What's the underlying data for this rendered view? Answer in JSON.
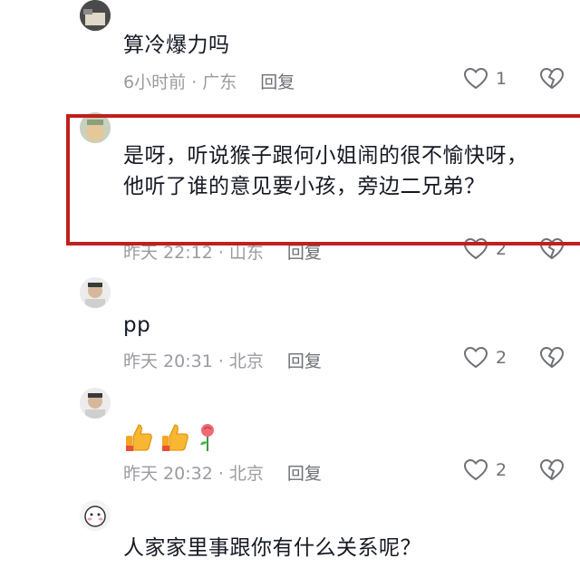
{
  "comments": [
    {
      "username": "",
      "content": "算冷爆力吗",
      "time_loc": "6小时前 · 广东",
      "reply_label": "回复",
      "likes": "1"
    },
    {
      "username": "",
      "content": "是呀，听说猴子跟何小姐闹的很不愉快呀，他听了谁的意见要小孩，旁边二兄弟？",
      "time_loc": "昨天 22:12 · 山东",
      "reply_label": "回复",
      "likes": "2"
    },
    {
      "username": "",
      "content": "pp",
      "time_loc": "昨天 20:31 · 北京",
      "reply_label": "回复",
      "likes": "2"
    },
    {
      "username": "",
      "content": "",
      "emojis": [
        "thumbs-up",
        "thumbs-up",
        "rose"
      ],
      "time_loc": "昨天 20:32 · 北京",
      "reply_label": "回复",
      "likes": "2"
    },
    {
      "username": "",
      "content": "人家家里事跟你有什么关系呢？"
    }
  ],
  "colors": {
    "highlight_border": "#c0201f",
    "meta_text": "#9a9ba0",
    "content_text": "#161823"
  },
  "icons": [
    "heart-outline-icon",
    "broken-heart-icon",
    "thumbs-up-emoji",
    "rose-emoji"
  ]
}
